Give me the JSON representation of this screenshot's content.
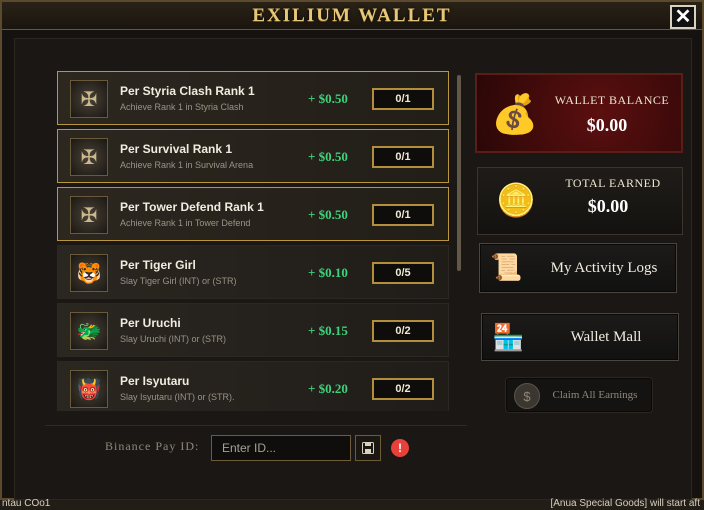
{
  "window": {
    "title": "EXILIUM WALLET",
    "close_label": "✕"
  },
  "quests": [
    {
      "title": "Per Styria Clash Rank 1",
      "subtitle": "Achieve Rank 1 in Styria Clash",
      "reward": "+ $0.50",
      "progress": "0/1",
      "icon": "rank-emblem-icon",
      "active": true
    },
    {
      "title": "Per Survival Rank 1",
      "subtitle": "Achieve Rank 1 in Survival Arena",
      "reward": "+ $0.50",
      "progress": "0/1",
      "icon": "rank-emblem-icon",
      "active": true
    },
    {
      "title": "Per Tower Defend Rank 1",
      "subtitle": "Achieve Rank 1 in Tower Defend",
      "reward": "+ $0.50",
      "progress": "0/1",
      "icon": "rank-emblem-icon",
      "active": true
    },
    {
      "title": "Per Tiger Girl",
      "subtitle": "Slay Tiger Girl (INT) or (STR)",
      "reward": "+ $0.10",
      "progress": "0/5",
      "icon": "tiger-icon",
      "active": false
    },
    {
      "title": "Per Uruchi",
      "subtitle": "Slay Uruchi (INT) or (STR)",
      "reward": "+ $0.15",
      "progress": "0/2",
      "icon": "dragon-icon",
      "active": false
    },
    {
      "title": "Per Isyutaru",
      "subtitle": "Slay Isyutaru (INT) or (STR).",
      "reward": "+ $0.20",
      "progress": "0/2",
      "icon": "demon-icon",
      "active": false
    }
  ],
  "wallet": {
    "balance_label": "WALLET BALANCE",
    "balance_value": "$0.00",
    "earned_label": "TOTAL EARNED",
    "earned_value": "$0.00"
  },
  "actions": {
    "activity_logs": "My Activity Logs",
    "wallet_mall": "Wallet Mall",
    "claim_all": "Claim All Earnings"
  },
  "binance": {
    "label": "Binance Pay ID:",
    "placeholder": "Enter ID..."
  },
  "footer": {
    "left_text": "ntau COo1",
    "right_text": "[Anua Special Goods] will start aft"
  },
  "colors": {
    "gold": "#e6c777",
    "reward_green": "#3ed27a",
    "balance_red": "#5c0f0f",
    "alert_red": "#e8413c"
  }
}
